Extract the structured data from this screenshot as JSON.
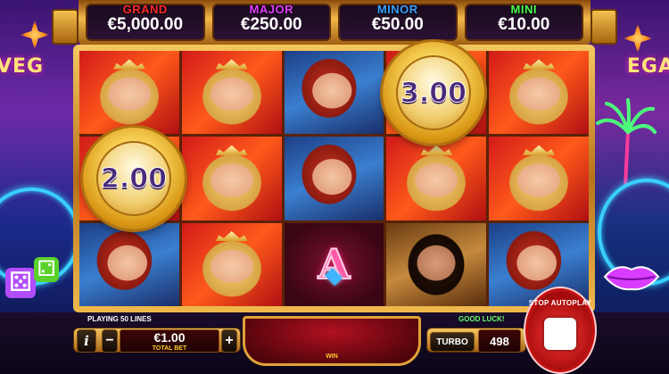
{
  "jackpots": [
    {
      "label": "GRAND",
      "value": "€5,000.00",
      "color": "#ff2a2a"
    },
    {
      "label": "MAJOR",
      "value": "€250.00",
      "color": "#e23cff"
    },
    {
      "label": "MINOR",
      "value": "€50.00",
      "color": "#3aa0ff"
    },
    {
      "label": "MINI",
      "value": "€10.00",
      "color": "#4cff4c"
    }
  ],
  "decor": {
    "left_sign": "VEG",
    "right_sign": "EGA"
  },
  "reels": [
    [
      "showgirl",
      "showgirl",
      "redhead",
      "showgirl",
      "showgirl"
    ],
    [
      "showgirl",
      "showgirl",
      "redhead",
      "showgirl",
      "showgirl"
    ],
    [
      "redhead",
      "showgirl",
      "A",
      "brunette",
      "redhead"
    ]
  ],
  "coins": {
    "coin_a": {
      "value": "2.00"
    },
    "coin_b": {
      "value": "3.00"
    }
  },
  "status": {
    "lines": "PLAYING 50 LINES",
    "good_luck": "GOOD LUCK!"
  },
  "controls": {
    "info": "i",
    "minus": "−",
    "plus": "+",
    "bet_value": "€1.00",
    "bet_label": "TOTAL BET",
    "win_label": "WIN",
    "turbo": "TURBO",
    "spins_left": "498",
    "stop_label": "STOP AUTOPLAY"
  },
  "icons": {
    "info": "info-icon",
    "dice": "dice-icon",
    "lips": "lips-icon",
    "palm": "palm-tree-icon",
    "star": "star-icon",
    "stop": "stop-icon"
  },
  "colors": {
    "gold": "#f3c460",
    "neon_blue": "#39d0ff",
    "stop_red": "#e01818"
  }
}
